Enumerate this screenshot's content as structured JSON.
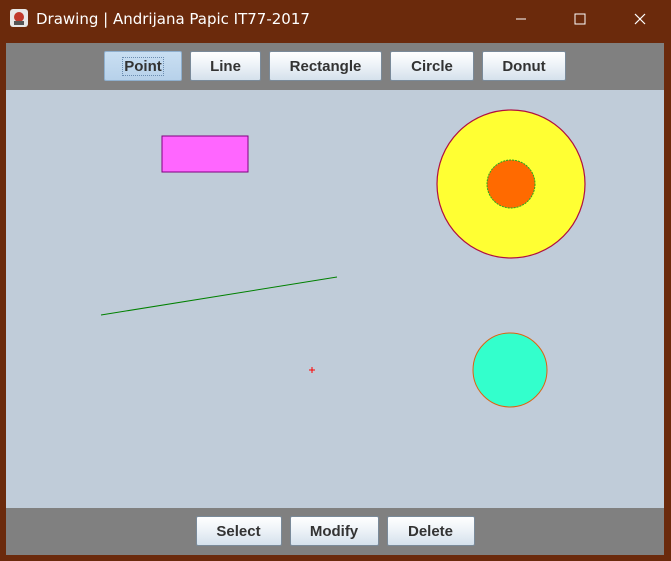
{
  "window": {
    "title": "Drawing | Andrijana Papic IT77-2017"
  },
  "toolbar": {
    "tools": [
      {
        "label": "Point",
        "selected": true
      },
      {
        "label": "Line",
        "selected": false
      },
      {
        "label": "Rectangle",
        "selected": false
      },
      {
        "label": "Circle",
        "selected": false
      },
      {
        "label": "Donut",
        "selected": false
      }
    ]
  },
  "actions": {
    "select": "Select",
    "modify": "Modify",
    "delete": "Delete"
  },
  "canvas": {
    "background": "#c0ccd9",
    "shapes": [
      {
        "type": "rectangle",
        "fill": "#ff66ff",
        "stroke": "#800080"
      },
      {
        "type": "donut",
        "outer_fill": "#ffff33",
        "outer_stroke": "#b01040",
        "inner_fill": "#ff6a00",
        "inner_stroke": "#22aa22"
      },
      {
        "type": "line",
        "stroke": "#008000"
      },
      {
        "type": "point",
        "stroke": "#ff0000"
      },
      {
        "type": "circle",
        "fill": "#33ffcc",
        "stroke": "#e06010"
      }
    ]
  },
  "colors": {
    "titlebar": "#6b2a0c",
    "toolbar": "#808080"
  }
}
